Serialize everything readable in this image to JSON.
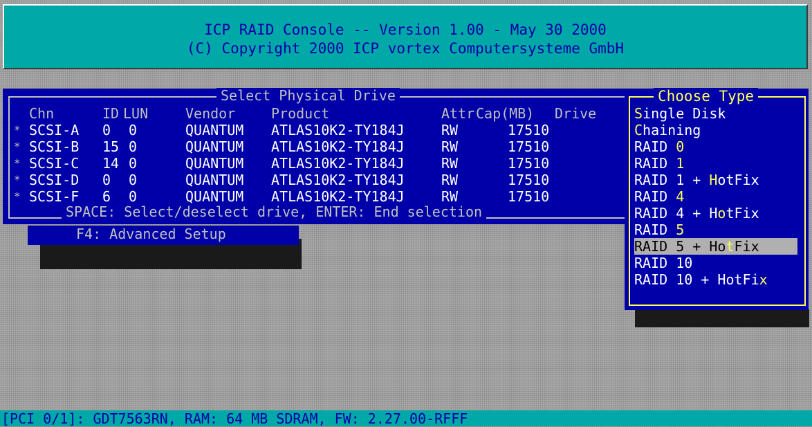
{
  "header": {
    "line1": "ICP RAID Console -- Version 1.00 - May 30 2000",
    "line2": "(C) Copyright 2000 ICP vortex Computersysteme GmbH"
  },
  "drive_window": {
    "title": "Select Physical Drive",
    "columns": [
      "Chn",
      "ID",
      "LUN",
      "Vendor",
      "Product",
      "Attr",
      "Cap(MB)",
      "Drive"
    ],
    "rows": [
      {
        "mark": "*",
        "chn": "SCSI-A",
        "id": "0",
        "lun": "0",
        "vendor": "QUANTUM",
        "product": "ATLAS10K2-TY184J",
        "attr": "RW",
        "cap": "17510"
      },
      {
        "mark": "*",
        "chn": "SCSI-B",
        "id": "15",
        "lun": "0",
        "vendor": "QUANTUM",
        "product": "ATLAS10K2-TY184J",
        "attr": "RW",
        "cap": "17510"
      },
      {
        "mark": "*",
        "chn": "SCSI-C",
        "id": "14",
        "lun": "0",
        "vendor": "QUANTUM",
        "product": "ATLAS10K2-TY184J",
        "attr": "RW",
        "cap": "17510"
      },
      {
        "mark": "*",
        "chn": "SCSI-D",
        "id": "0",
        "lun": "0",
        "vendor": "QUANTUM",
        "product": "ATLAS10K2-TY184J",
        "attr": "RW",
        "cap": "17510"
      },
      {
        "mark": "*",
        "chn": "SCSI-F",
        "id": "6",
        "lun": "0",
        "vendor": "QUANTUM",
        "product": "ATLAS10K2-TY184J",
        "attr": "RW",
        "cap": "17510"
      }
    ],
    "footer": "SPACE: Select/deselect drive, ENTER: End selection"
  },
  "advanced_setup": {
    "label": "F4: Advanced Setup"
  },
  "type_menu": {
    "title": "Choose Type",
    "options": [
      {
        "pre": "",
        "key": "S",
        "post": "ingle Disk"
      },
      {
        "pre": "",
        "key": "C",
        "post": "haining"
      },
      {
        "pre": "RAID ",
        "key": "0",
        "post": ""
      },
      {
        "pre": "RAID ",
        "key": "1",
        "post": ""
      },
      {
        "pre": "RAID 1 + ",
        "key": "H",
        "post": "otFix"
      },
      {
        "pre": "RAID ",
        "key": "4",
        "post": ""
      },
      {
        "pre": "RAID 4 + H",
        "key": "o",
        "post": "tFix"
      },
      {
        "pre": "RAID ",
        "key": "5",
        "post": ""
      },
      {
        "pre": "RAID 5 + Ho",
        "key": "t",
        "post": "Fix"
      },
      {
        "pre": "RAID 10",
        "key": "",
        "post": ""
      },
      {
        "pre": "RAID 10 + HotFi",
        "key": "x",
        "post": ""
      }
    ],
    "selected_index": 8
  },
  "status_bar": {
    "text": "[PCI 0/1]: GDT7563RN, RAM: 64 MB SDRAM, FW: 2.27.00-RFFF"
  },
  "colors": {
    "window": "#0000a8",
    "header": "#00a8a8",
    "hotkey": "#ffff55",
    "selection": "#b0b0b0"
  }
}
